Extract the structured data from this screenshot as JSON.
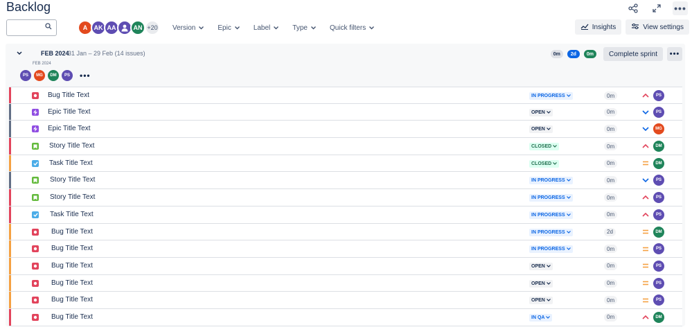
{
  "page": {
    "title": "Backlog"
  },
  "header_icons": [
    "share-icon",
    "expand-icon",
    "more-icon"
  ],
  "toolbar": {
    "search": {
      "value": "",
      "placeholder": ""
    },
    "avatars": [
      {
        "initials": "A",
        "color": "#e34a1e"
      },
      {
        "initials": "AK",
        "color": "#5e4db2"
      },
      {
        "initials": "AA",
        "color": "#5e4db2"
      },
      {
        "initials": "",
        "color": "#5e4db2"
      },
      {
        "initials": "AN",
        "color": "#1f845a"
      }
    ],
    "more_avatars": "+20",
    "filters": [
      "Version",
      "Epic",
      "Label",
      "Type",
      "Quick filters"
    ],
    "insights_label": "Insights",
    "view_settings_label": "View settings"
  },
  "sprint": {
    "name": "FEB 2024",
    "dates": "31 Jan – 29 Feb",
    "issue_count": "(14 issues)",
    "subtitle": "FEB 2024",
    "assignees": [
      {
        "initials": "PS",
        "color": "#5e4db2"
      },
      {
        "initials": "MG",
        "color": "#e34a1e"
      },
      {
        "initials": "DM",
        "color": "#1f845a"
      },
      {
        "initials": "PS",
        "color": "#5e4db2"
      }
    ],
    "estimates": {
      "todo": "0m",
      "in_progress": "2d",
      "done": "0m"
    },
    "complete_label": "Complete sprint"
  },
  "issues": [
    {
      "type": "bug",
      "title": "Bug Title Text",
      "status": "IN PROGRESS",
      "status_style": "blue",
      "estimate": "0m",
      "priority": "high",
      "assignee": "PS",
      "assignee_color": "#5e4db2",
      "bar": "#e2445c"
    },
    {
      "type": "epic",
      "title": "Epic Title Text",
      "status": "OPEN",
      "status_style": "gray",
      "estimate": "0m",
      "priority": "low",
      "assignee": "PS",
      "assignee_color": "#5e4db2",
      "bar": "#626f86"
    },
    {
      "type": "epic",
      "title": "Epic Title Text",
      "status": "OPEN",
      "status_style": "gray",
      "estimate": "0m",
      "priority": "low",
      "assignee": "MG",
      "assignee_color": "#e34a1e",
      "bar": "#626f86"
    },
    {
      "type": "story",
      "title": "Story Title Text",
      "status": "CLOSED",
      "status_style": "green",
      "estimate": "0m",
      "priority": "high",
      "assignee": "DM",
      "assignee_color": "#1f845a",
      "bar": "#e2445c"
    },
    {
      "type": "task",
      "title": "Task Title Text",
      "status": "CLOSED",
      "status_style": "green",
      "estimate": "0m",
      "priority": "medium",
      "assignee": "DM",
      "assignee_color": "#1f845a",
      "bar": "#f5a142"
    },
    {
      "type": "story",
      "title": "Story Title Text",
      "status": "IN PROGRESS",
      "status_style": "blue",
      "estimate": "0m",
      "priority": "low",
      "assignee": "PS",
      "assignee_color": "#5e4db2",
      "bar": "#626f86"
    },
    {
      "type": "story",
      "title": "Story Title Text",
      "status": "IN PROGRESS",
      "status_style": "blue",
      "estimate": "0m",
      "priority": "high",
      "assignee": "PS",
      "assignee_color": "#5e4db2",
      "bar": "#e2445c"
    },
    {
      "type": "task",
      "title": "Task Title Text",
      "status": "IN PROGRESS",
      "status_style": "blue",
      "estimate": "0m",
      "priority": "high",
      "assignee": "PS",
      "assignee_color": "#5e4db2",
      "bar": "#e2445c"
    },
    {
      "type": "bug",
      "title": "Bug Title Text",
      "status": "IN PROGRESS",
      "status_style": "blue",
      "estimate": "2d",
      "priority": "medium",
      "assignee": "DM",
      "assignee_color": "#1f845a",
      "bar": "#f5a142"
    },
    {
      "type": "bug",
      "title": "Bug Title Text",
      "status": "IN PROGRESS",
      "status_style": "blue",
      "estimate": "0m",
      "priority": "medium",
      "assignee": "PS",
      "assignee_color": "#5e4db2",
      "bar": "#f5a142"
    },
    {
      "type": "bug",
      "title": "Bug Title Text",
      "status": "OPEN",
      "status_style": "gray",
      "estimate": "0m",
      "priority": "medium",
      "assignee": "PS",
      "assignee_color": "#5e4db2",
      "bar": "#f5a142"
    },
    {
      "type": "bug",
      "title": "Bug Title Text",
      "status": "OPEN",
      "status_style": "gray",
      "estimate": "0m",
      "priority": "medium",
      "assignee": "PS",
      "assignee_color": "#5e4db2",
      "bar": "#f5a142"
    },
    {
      "type": "bug",
      "title": "Bug Title Text",
      "status": "OPEN",
      "status_style": "gray",
      "estimate": "0m",
      "priority": "medium",
      "assignee": "PS",
      "assignee_color": "#5e4db2",
      "bar": "#f5a142"
    },
    {
      "type": "bug",
      "title": "Bug Title Text",
      "status": "IN QA",
      "status_style": "blue",
      "estimate": "0m",
      "priority": "high",
      "assignee": "DM",
      "assignee_color": "#1f845a",
      "bar": "#e2445c"
    }
  ],
  "type_styles": {
    "bug": {
      "color": "#e2445c",
      "icon": "bug-icon"
    },
    "epic": {
      "color": "#904ee2",
      "icon": "epic-icon"
    },
    "story": {
      "color": "#63ba3c",
      "icon": "story-icon"
    },
    "task": {
      "color": "#4bade8",
      "icon": "task-icon"
    }
  },
  "priority_styles": {
    "high": {
      "color": "#e2445c",
      "icon": "priority-high-icon"
    },
    "medium": {
      "color": "#f5a142",
      "icon": "priority-medium-icon"
    },
    "low": {
      "color": "#0c66e4",
      "icon": "priority-low-icon"
    }
  }
}
